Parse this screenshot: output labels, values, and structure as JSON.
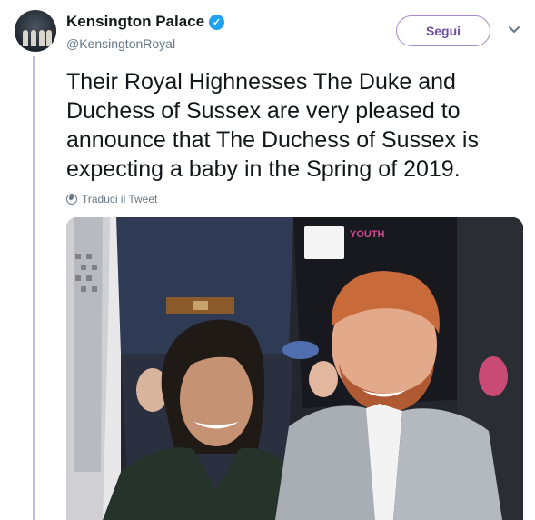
{
  "account": {
    "display_name": "Kensington Palace",
    "handle": "@KensingtonRoyal",
    "verified_glyph": "✓"
  },
  "actions": {
    "follow_label": "Segui"
  },
  "tweet": {
    "text": "Their Royal Highnesses The Duke and Duchess of Sussex are very pleased to announce that The Duchess of Sussex is expecting a baby in the Spring of 2019.",
    "translate_label": "Traduci il Tweet"
  },
  "media": {
    "badge_text": "YOUTH"
  },
  "colors": {
    "accent": "#6e4fa3",
    "verified": "#1da1f2",
    "thread_line": "#c9b6d9"
  },
  "icons": [
    "verified-badge-icon",
    "chevron-down-icon",
    "globe-icon"
  ]
}
